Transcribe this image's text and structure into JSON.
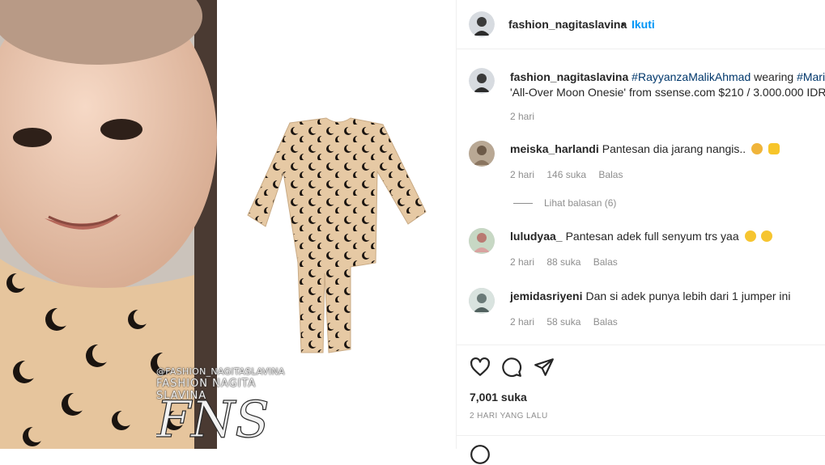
{
  "header": {
    "username": "fashion_nagitaslavina",
    "dot": "•",
    "follow_label": "Ikuti"
  },
  "caption": {
    "username": "fashion_nagitaslavina",
    "tag1": "#RayyanzaMalikAhmad",
    "text1": "wearing",
    "tag2": "#MarineS",
    "line2": "'All-Over Moon Onesie' from ssense.com $210 / 3.000.000 IDR",
    "time": "2 hari"
  },
  "watermark": {
    "handle": "@FASHION_NAGITASLAVINA",
    "name": "FASHION NAGITA SLAVINA"
  },
  "comments": [
    {
      "user": "meiska_harlandi",
      "text": "Pantesan dia jarang nangis..",
      "time": "2 hari",
      "likes": "146 suka",
      "reply": "Balas"
    },
    {
      "user": "luludyaa_",
      "text": "Pantesan adek full senyum trs yaa",
      "time": "2 hari",
      "likes": "88 suka",
      "reply": "Balas"
    },
    {
      "user": "jemidasriyeni",
      "text": "Dan si adek punya lebih dari 1 jumper ini",
      "time": "2 hari",
      "likes": "58 suka",
      "reply": "Balas"
    }
  ],
  "replies_label": "Lihat balasan (6)",
  "likes_count": "7,001 suka",
  "post_date": "2 HARI YANG LALU",
  "colors": {
    "accent": "#0095f6",
    "hashtag": "#00376b",
    "onesie": "#e6c9a4",
    "moon": "#1a1410"
  },
  "icons": [
    "heart-icon",
    "comment-icon",
    "share-icon"
  ]
}
